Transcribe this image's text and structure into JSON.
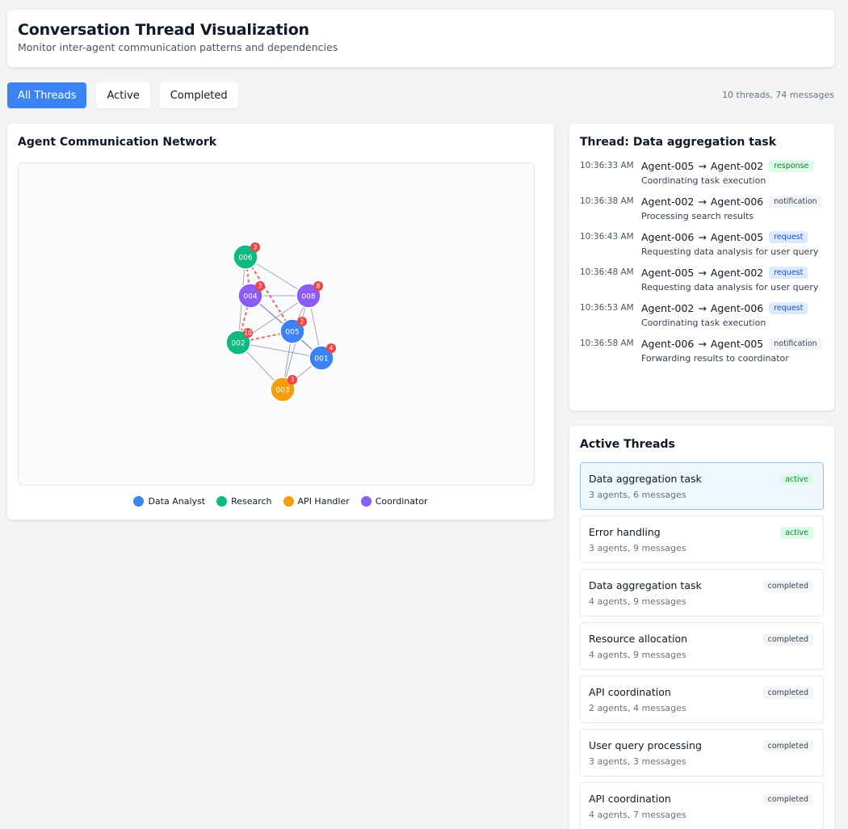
{
  "header": {
    "title": "Conversation Thread Visualization",
    "subtitle": "Monitor inter-agent communication patterns and dependencies"
  },
  "filters": [
    {
      "label": "All Threads",
      "active": true
    },
    {
      "label": "Active",
      "active": false
    },
    {
      "label": "Completed",
      "active": false
    }
  ],
  "summary": "10 threads, 74 messages",
  "network": {
    "title": "Agent Communication Network",
    "legend": [
      {
        "label": "Data Analyst",
        "color": "#3b82f6"
      },
      {
        "label": "Research",
        "color": "#10b981"
      },
      {
        "label": "API Handler",
        "color": "#f59e0b"
      },
      {
        "label": "Coordinator",
        "color": "#8b5cf6"
      }
    ],
    "nodes": [
      {
        "id": "006",
        "role": "Research",
        "badge": "3"
      },
      {
        "id": "004",
        "role": "Coordinator",
        "badge": "3"
      },
      {
        "id": "008",
        "role": "Coordinator",
        "badge": "8"
      },
      {
        "id": "005",
        "role": "Data Analyst",
        "badge": "2"
      },
      {
        "id": "002",
        "role": "Research",
        "badge": "10"
      },
      {
        "id": "001",
        "role": "Data Analyst",
        "badge": "4"
      },
      {
        "id": "003",
        "role": "API Handler",
        "badge": "3"
      }
    ],
    "edges": [
      {
        "from": "006",
        "to": "008",
        "highlight": false
      },
      {
        "from": "006",
        "to": "004",
        "highlight": true
      },
      {
        "from": "006",
        "to": "005",
        "highlight": true
      },
      {
        "from": "006",
        "to": "002",
        "highlight": false
      },
      {
        "from": "004",
        "to": "008",
        "highlight": false
      },
      {
        "from": "004",
        "to": "002",
        "highlight": true
      },
      {
        "from": "004",
        "to": "001",
        "highlight": false
      },
      {
        "from": "004",
        "to": "005",
        "highlight": false
      },
      {
        "from": "008",
        "to": "005",
        "highlight": false
      },
      {
        "from": "008",
        "to": "002",
        "highlight": false
      },
      {
        "from": "008",
        "to": "001",
        "highlight": false
      },
      {
        "from": "008",
        "to": "003",
        "highlight": false
      },
      {
        "from": "005",
        "to": "002",
        "highlight": true
      },
      {
        "from": "005",
        "to": "001",
        "highlight": false
      },
      {
        "from": "005",
        "to": "003",
        "highlight": false
      },
      {
        "from": "002",
        "to": "001",
        "highlight": false
      },
      {
        "from": "002",
        "to": "003",
        "highlight": false
      },
      {
        "from": "001",
        "to": "003",
        "highlight": false
      }
    ]
  },
  "thread_detail": {
    "title": "Thread: Data aggregation task",
    "messages": [
      {
        "time": "10:36:33 AM",
        "from": "Agent-005",
        "to": "Agent-002",
        "arrow": "→",
        "type": "response",
        "text": "Coordinating task execution"
      },
      {
        "time": "10:36:38 AM",
        "from": "Agent-002",
        "to": "Agent-006",
        "arrow": "→",
        "type": "notification",
        "text": "Processing search results"
      },
      {
        "time": "10:36:43 AM",
        "from": "Agent-006",
        "to": "Agent-005",
        "arrow": "→",
        "type": "request",
        "text": "Requesting data analysis for user query"
      },
      {
        "time": "10:36:48 AM",
        "from": "Agent-005",
        "to": "Agent-002",
        "arrow": "→",
        "type": "request",
        "text": "Requesting data analysis for user query"
      },
      {
        "time": "10:36:53 AM",
        "from": "Agent-002",
        "to": "Agent-006",
        "arrow": "→",
        "type": "request",
        "text": "Coordinating task execution"
      },
      {
        "time": "10:36:58 AM",
        "from": "Agent-006",
        "to": "Agent-005",
        "arrow": "→",
        "type": "notification",
        "text": "Forwarding results to coordinator"
      }
    ]
  },
  "active_threads": {
    "title": "Active Threads",
    "items": [
      {
        "name": "Data aggregation task",
        "meta": "3 agents, 6 messages",
        "status": "active",
        "selected": true
      },
      {
        "name": "Error handling",
        "meta": "3 agents, 9 messages",
        "status": "active",
        "selected": false
      },
      {
        "name": "Data aggregation task",
        "meta": "4 agents, 9 messages",
        "status": "completed",
        "selected": false
      },
      {
        "name": "Resource allocation",
        "meta": "4 agents, 9 messages",
        "status": "completed",
        "selected": false
      },
      {
        "name": "API coordination",
        "meta": "2 agents, 4 messages",
        "status": "completed",
        "selected": false
      },
      {
        "name": "User query processing",
        "meta": "3 agents, 3 messages",
        "status": "completed",
        "selected": false
      },
      {
        "name": "API coordination",
        "meta": "4 agents, 7 messages",
        "status": "completed",
        "selected": false
      }
    ]
  }
}
